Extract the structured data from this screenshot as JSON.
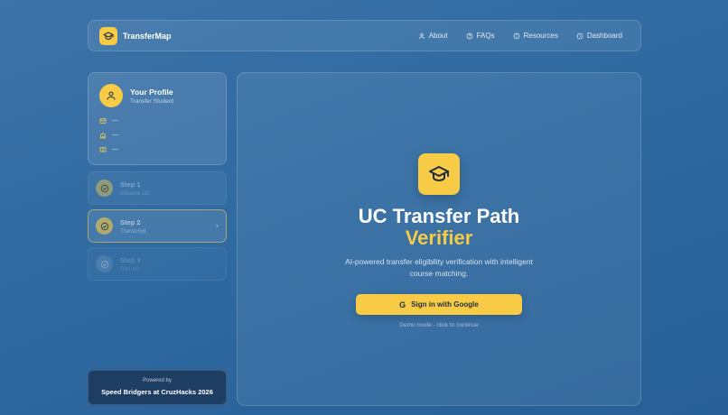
{
  "colors": {
    "accent": "#f7cb45",
    "background": "#2f6aa1",
    "footer_bg": "#1e3d63",
    "button_text": "#1f2d40"
  },
  "header": {
    "brand_name": "TransferMap",
    "brand_icon": "graduation-cap-icon",
    "nav": [
      {
        "label": "About",
        "icon": "user-icon"
      },
      {
        "label": "FAQs",
        "icon": "help-circle-icon"
      },
      {
        "label": "Resources",
        "icon": "info-circle-icon"
      },
      {
        "label": "Dashboard",
        "icon": "clock-icon"
      }
    ]
  },
  "profile": {
    "title": "Your Profile",
    "subtitle": "Transfer Student",
    "rows": [
      {
        "icon": "mail-icon",
        "value": "—"
      },
      {
        "icon": "school-icon",
        "value": "—"
      },
      {
        "icon": "book-icon",
        "value": "—"
      }
    ]
  },
  "steps": [
    {
      "title": "Step 1",
      "subtitle": "Choose UC",
      "state": "inactive"
    },
    {
      "title": "Step 2",
      "subtitle": "Transcript",
      "state": "active"
    },
    {
      "title": "Step 3",
      "subtitle": "Results",
      "state": "disabled"
    }
  ],
  "footer": {
    "powered_by": "Powered by",
    "credit": "Speed Bridgers at CruzHacks 2026"
  },
  "hero": {
    "icon": "graduation-cap-icon",
    "title": "UC Transfer Path",
    "title_accent": "Verifier",
    "description": "AI-powered transfer eligibility verification with intelligent course matching.",
    "signin_label": "Sign in with Google",
    "demo_note": "Demo mode - click to continue"
  }
}
